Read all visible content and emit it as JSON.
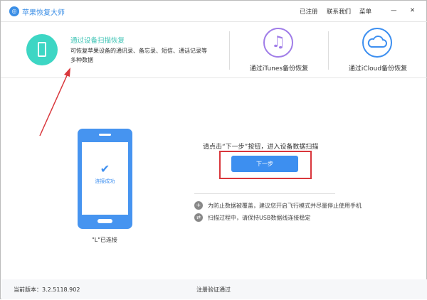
{
  "app": {
    "title": "苹果恢复大师",
    "registered": "已注册",
    "contact": "联系我们",
    "menu": "菜单",
    "minimize": "—",
    "close": "✕"
  },
  "tabs": [
    {
      "title": "通过设备扫描恢复",
      "desc1": "可恢复苹果设备的通讯录、备忘录、短信、通话记录等",
      "desc2": "多种数据",
      "active": true
    },
    {
      "title": "通过iTunes备份恢复",
      "icon": "music-note-icon"
    },
    {
      "title": "通过iCloud备份恢复",
      "icon": "cloud-icon"
    }
  ],
  "device": {
    "status": "连接成功",
    "name": "\"L\"已连接"
  },
  "main": {
    "prompt": "请点击“下一步”按钮，进入设备数据扫描",
    "next": "下一步",
    "tips": [
      "为防止数据被覆盖，建议您开启飞行模式并尽量停止使用手机",
      "扫描过程中，请保持USB数据线连接稳定"
    ]
  },
  "footer": {
    "version": "当前版本：3.2.5118.902",
    "register": "注册验证通过"
  },
  "colors": {
    "accent": "#3d8ff0",
    "teal": "#3dd6c4",
    "purple": "#a07de8",
    "highlight": "#d9373c"
  }
}
